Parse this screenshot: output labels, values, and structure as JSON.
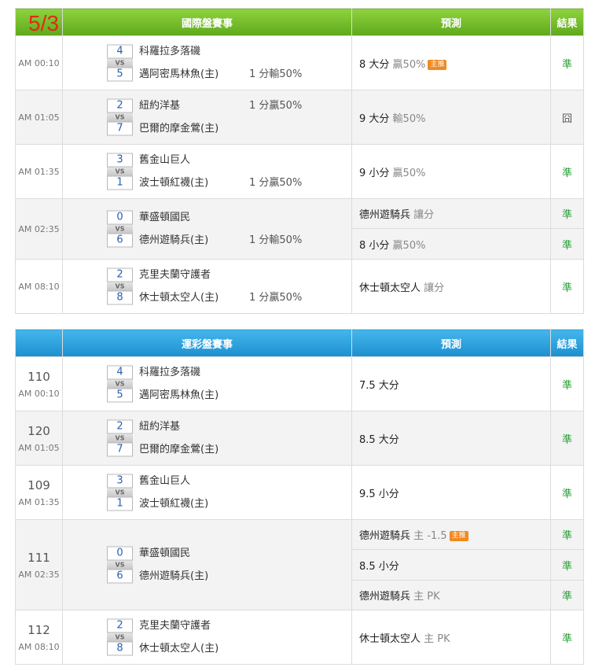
{
  "date": "5/3",
  "table1": {
    "header": {
      "match": "國際盤賽事",
      "prediction": "預測",
      "result": "結果"
    },
    "rows": [
      {
        "time": "AM 00:10",
        "team1": "科羅拉多落磯",
        "score1": "4",
        "team2": "邁阿密馬林魚(主)",
        "score2": "5",
        "hc_line": 2,
        "handicap": "1 分輸50%",
        "preds": [
          {
            "text": "8 大分",
            "note": "贏50%",
            "tag": "主推",
            "result": "準"
          }
        ]
      },
      {
        "time": "AM 01:05",
        "team1": "紐約洋基",
        "score1": "2",
        "team2": "巴爾的摩金鶯(主)",
        "score2": "7",
        "hc_line": 1,
        "handicap": "1 分贏50%",
        "preds": [
          {
            "text": "9 大分",
            "note": "輸50%",
            "tag": "",
            "result": "囧"
          }
        ]
      },
      {
        "time": "AM 01:35",
        "team1": "舊金山巨人",
        "score1": "3",
        "team2": "波士頓紅襪(主)",
        "score2": "1",
        "hc_line": 2,
        "handicap": "1 分贏50%",
        "preds": [
          {
            "text": "9 小分",
            "note": "贏50%",
            "tag": "",
            "result": "準"
          }
        ]
      },
      {
        "time": "AM 02:35",
        "team1": "華盛頓國民",
        "score1": "0",
        "team2": "德州遊騎兵(主)",
        "score2": "6",
        "hc_line": 2,
        "handicap": "1 分輸50%",
        "preds": [
          {
            "text": "德州遊騎兵",
            "note": "讓分",
            "tag": "",
            "result": "準"
          },
          {
            "text": "8 小分",
            "note": "贏50%",
            "tag": "",
            "result": "準"
          }
        ]
      },
      {
        "time": "AM 08:10",
        "team1": "克里夫蘭守護者",
        "score1": "2",
        "team2": "休士頓太空人(主)",
        "score2": "8",
        "hc_line": 2,
        "handicap": "1 分贏50%",
        "preds": [
          {
            "text": "休士頓太空人",
            "note": "讓分",
            "tag": "",
            "result": "準"
          }
        ]
      }
    ]
  },
  "table2": {
    "header": {
      "match": "運彩盤賽事",
      "prediction": "預測",
      "result": "結果"
    },
    "rows": [
      {
        "no": "110",
        "time": "AM 00:10",
        "team1": "科羅拉多落磯",
        "score1": "4",
        "team2": "邁阿密馬林魚(主)",
        "score2": "5",
        "preds": [
          {
            "text": "7.5 大分",
            "note": "",
            "tag": "",
            "result": "準"
          }
        ]
      },
      {
        "no": "120",
        "time": "AM 01:05",
        "team1": "紐約洋基",
        "score1": "2",
        "team2": "巴爾的摩金鶯(主)",
        "score2": "7",
        "preds": [
          {
            "text": "8.5 大分",
            "note": "",
            "tag": "",
            "result": "準"
          }
        ]
      },
      {
        "no": "109",
        "time": "AM 01:35",
        "team1": "舊金山巨人",
        "score1": "3",
        "team2": "波士頓紅襪(主)",
        "score2": "1",
        "preds": [
          {
            "text": "9.5 小分",
            "note": "",
            "tag": "",
            "result": "準"
          }
        ]
      },
      {
        "no": "111",
        "time": "AM 02:35",
        "team1": "華盛頓國民",
        "score1": "0",
        "team2": "德州遊騎兵(主)",
        "score2": "6",
        "preds": [
          {
            "text": "德州遊騎兵",
            "note": "主 -1.5",
            "tag": "主推",
            "result": "準"
          },
          {
            "text": "8.5 小分",
            "note": "",
            "tag": "",
            "result": "準"
          },
          {
            "text": "德州遊騎兵",
            "note": "主 PK",
            "tag": "",
            "result": "準"
          }
        ]
      },
      {
        "no": "112",
        "time": "AM 08:10",
        "team1": "克里夫蘭守護者",
        "score1": "2",
        "team2": "休士頓太空人(主)",
        "score2": "8",
        "preds": [
          {
            "text": "休士頓太空人",
            "note": "主 PK",
            "tag": "",
            "result": "準"
          }
        ]
      }
    ]
  }
}
